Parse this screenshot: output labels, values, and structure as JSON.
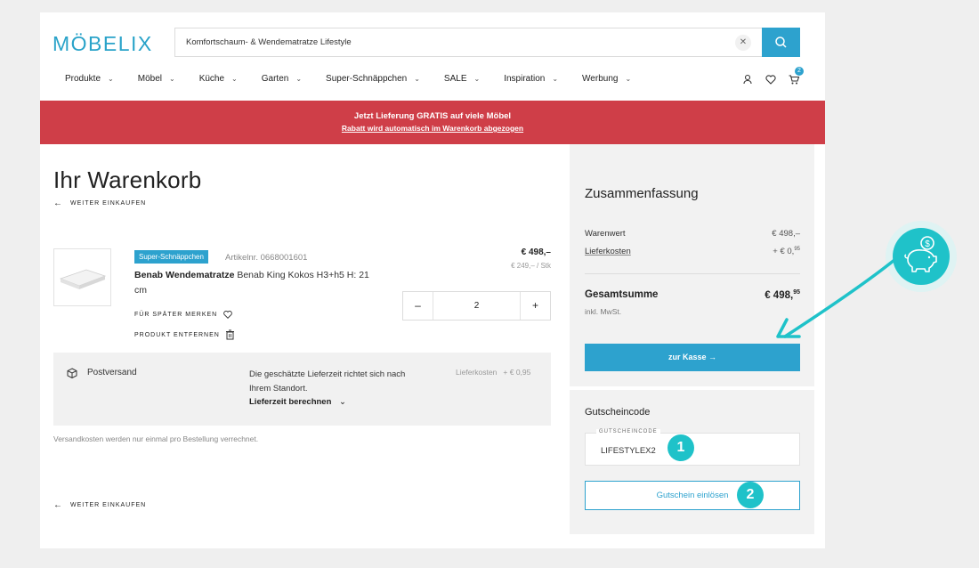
{
  "header": {
    "logo": "MÖBELIX",
    "search_value": "Komfortschaum- & Wendematratze Lifestyle",
    "clear_icon": "close-icon",
    "search_icon": "search-icon",
    "cart_count": "2"
  },
  "nav": {
    "items": [
      "Produkte",
      "Möbel",
      "Küche",
      "Garten",
      "Super-Schnäppchen",
      "SALE",
      "Inspiration",
      "Werbung"
    ]
  },
  "banner": {
    "line1": "Jetzt Lieferung GRATIS auf viele Möbel",
    "line2": "Rabatt wird automatisch im Warenkorb abgezogen",
    "color": "#cf3e48"
  },
  "cart": {
    "title": "Ihr Warenkorb",
    "continue_top": "WEITER EINKAUFEN",
    "continue_bottom": "WEITER EINKAUFEN",
    "item": {
      "badge": "Super-Schnäppchen",
      "article_no": "Artikelnr. 0668001601",
      "name_bold": "Benab Wendematratze",
      "name_rest": " Benab King Kokos H3+h5 H: 21 cm",
      "save_later": "FÜR SPÄTER MERKEN",
      "remove": "PRODUKT ENTFERNEN",
      "price": "€ 498,–",
      "unit_price": "€ 249,– / Stk",
      "quantity": "2",
      "minus": "–",
      "plus": "+"
    },
    "shipping": {
      "method": "Postversand",
      "desc": "Die geschätzte Lieferzeit richtet sich nach Ihrem Standort.",
      "calc": "Lieferzeit berechnen",
      "cost_label": "Lieferkosten",
      "cost_value": "+ € 0,95"
    },
    "note": "Versandkosten werden nur einmal pro Bestellung verrechnet."
  },
  "summary": {
    "title": "Zusammenfassung",
    "goods_label": "Warenwert",
    "goods_value": "€ 498,–",
    "delivery_label": "Lieferkosten",
    "delivery_value": "+ € 0,",
    "delivery_cents": "95",
    "total_label": "Gesamtsumme",
    "total_value": "€ 498,",
    "total_cents": "95",
    "tax": "inkl. MwSt.",
    "checkout": "zur Kasse →"
  },
  "voucher": {
    "title": "Gutscheincode",
    "field_label": "GUTSCHEINCODE",
    "field_value": "LIFESTYLEX2",
    "button": "Gutschein einlösen",
    "marker1": "1",
    "marker2": "2"
  },
  "colors": {
    "accent": "#2da2ce",
    "marker": "#1fc2c9"
  }
}
